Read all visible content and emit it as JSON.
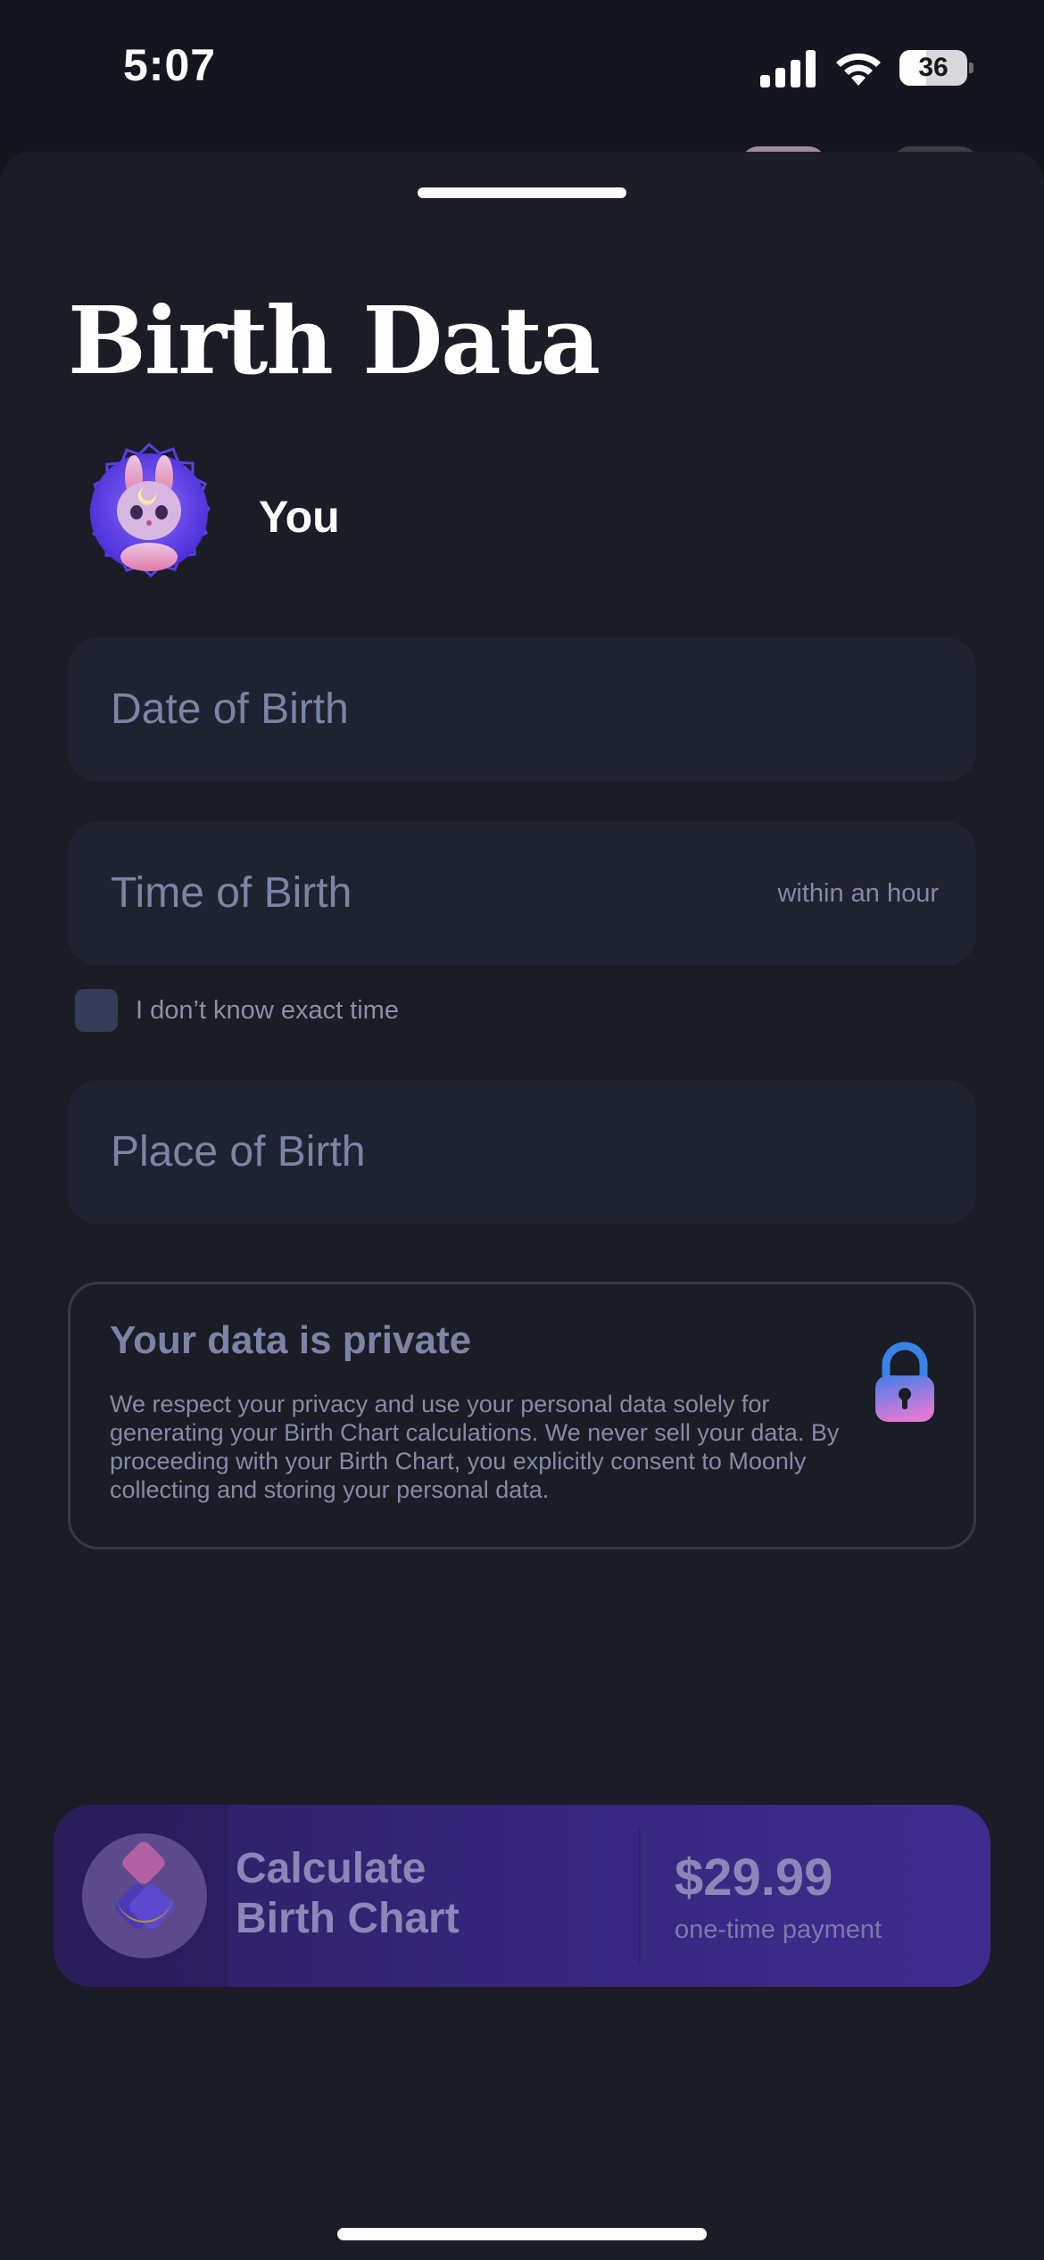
{
  "status_bar": {
    "time": "5:07",
    "battery_level": "36",
    "icons": [
      "cellular-signal-icon",
      "wifi-icon",
      "battery-icon"
    ]
  },
  "sheet": {
    "title": "Birth Data",
    "profile": {
      "name": "You",
      "avatar_icon": "bunny-avatar-icon"
    }
  },
  "fields": {
    "date": {
      "label": "Date of Birth"
    },
    "time": {
      "label": "Time of Birth",
      "hint": "within an hour"
    },
    "unknown_time": {
      "label": "I don’t know exact time",
      "checked": false
    },
    "place": {
      "label": "Place of Birth"
    }
  },
  "privacy": {
    "title": "Your data is private",
    "body": "We respect your privacy and use your personal data solely for generating your Birth Chart calculations. We never sell your data. By proceeding with your Birth Chart, you explicitly consent to Moonly collecting and storing your personal data.",
    "icon": "lock-icon"
  },
  "cta": {
    "label_line1": "Calculate",
    "label_line2": "Birth Chart",
    "price": "$29.99",
    "price_note": "one-time payment",
    "icon": "birth-chart-icon"
  },
  "colors": {
    "background": "#13161e",
    "sheet": "#1a1c26",
    "field": "#1f2230",
    "muted_text": "#7c84a6",
    "cta_start": "#2c1f5e",
    "cta_end": "#3f2c8e"
  }
}
